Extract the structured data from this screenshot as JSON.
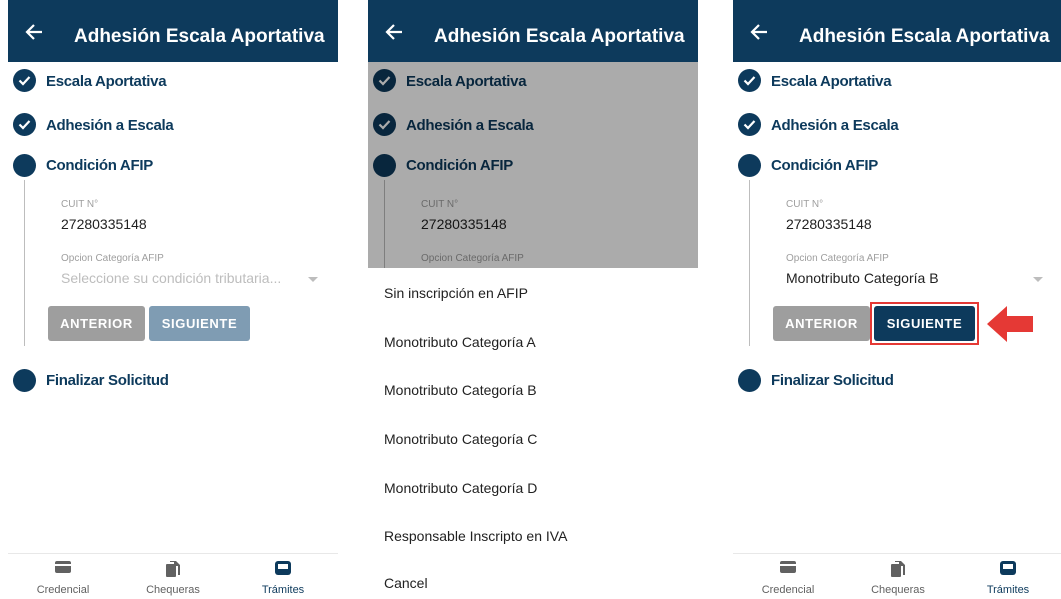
{
  "app": {
    "title": "Adhesión Escala Aportativa"
  },
  "steps": {
    "step1": "Escala Aportativa",
    "step2": "Adhesión a Escala",
    "step3": "Condición AFIP",
    "step4": "Finalizar Solicitud"
  },
  "form": {
    "cuit_label": "CUIT N°",
    "cuit_value": "27280335148",
    "categoria_label": "Opcion Categoría AFIP",
    "categoria_placeholder": "Seleccione su condición tributaria...",
    "categoria_selected": "Monotributo Categoría B"
  },
  "buttons": {
    "anterior": "ANTERIOR",
    "siguiente": "SIGUIENTE"
  },
  "picker": {
    "options": [
      "Sin inscripción en AFIP",
      "Monotributo Categoría A",
      "Monotributo Categoría B",
      "Monotributo Categoría C",
      "Monotributo Categoría D",
      "Responsable Inscripto en IVA"
    ],
    "cancel": "Cancel"
  },
  "nav": {
    "credencial": "Credencial",
    "chequeras": "Chequeras",
    "tramites": "Trámites"
  },
  "colors": {
    "primary": "#0d3a5c",
    "button_disabled": "#7f9cb3",
    "button_secondary": "#9e9e9e",
    "highlight": "#e53935"
  },
  "icons": {
    "back": "arrow-left-icon",
    "done": "check-circle-icon",
    "credencial": "card-icon",
    "chequeras": "documents-icon",
    "tramites": "inbox-tray-icon",
    "pointer": "red-arrow-icon"
  }
}
